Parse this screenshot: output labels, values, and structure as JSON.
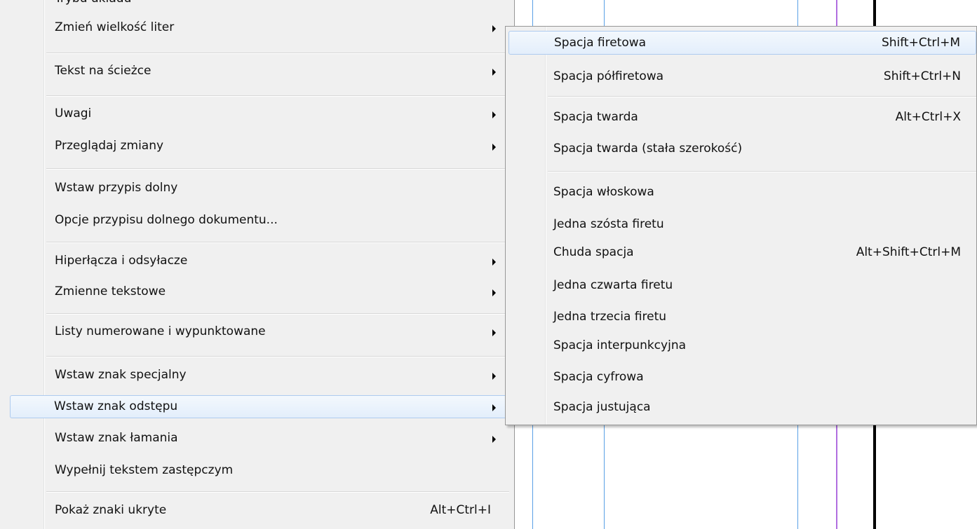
{
  "main_menu": {
    "partial_top_label": "Trybu układu",
    "items": [
      {
        "label": "Zmień wielkość liter",
        "shortcut": "",
        "submenu": true
      },
      {
        "label": "Tekst na ścieżce",
        "shortcut": "",
        "submenu": true
      },
      {
        "label": "Uwagi",
        "shortcut": "",
        "submenu": true
      },
      {
        "label": "Przeglądaj zmiany",
        "shortcut": "",
        "submenu": true
      },
      {
        "label": "Wstaw przypis dolny",
        "shortcut": "",
        "submenu": false
      },
      {
        "label": "Opcje przypisu dolnego dokumentu...",
        "shortcut": "",
        "submenu": false
      },
      {
        "label": "Hiperłącza i odsyłacze",
        "shortcut": "",
        "submenu": true
      },
      {
        "label": "Zmienne tekstowe",
        "shortcut": "",
        "submenu": true
      },
      {
        "label": "Listy numerowane i wypunktowane",
        "shortcut": "",
        "submenu": true
      },
      {
        "label": "Wstaw znak specjalny",
        "shortcut": "",
        "submenu": true
      },
      {
        "label": "Wstaw znak odstępu",
        "shortcut": "",
        "submenu": true,
        "highlighted": true
      },
      {
        "label": "Wstaw znak łamania",
        "shortcut": "",
        "submenu": true
      },
      {
        "label": "Wypełnij tekstem zastępczym",
        "shortcut": "",
        "submenu": false
      },
      {
        "label": "Pokaż znaki ukryte",
        "shortcut": "Alt+Ctrl+I",
        "submenu": false
      }
    ]
  },
  "sub_menu": {
    "items": [
      {
        "label": "Spacja firetowa",
        "shortcut": "Shift+Ctrl+M",
        "highlighted": true
      },
      {
        "label": "Spacja półfiretowa",
        "shortcut": "Shift+Ctrl+N"
      },
      {
        "label": "Spacja twarda",
        "shortcut": "Alt+Ctrl+X"
      },
      {
        "label": "Spacja twarda (stała szerokość)",
        "shortcut": ""
      },
      {
        "label": "Spacja włoskowa",
        "shortcut": ""
      },
      {
        "label": "Jedna szósta firetu",
        "shortcut": ""
      },
      {
        "label": "Chuda spacja",
        "shortcut": "Alt+Shift+Ctrl+M"
      },
      {
        "label": "Jedna czwarta firetu",
        "shortcut": ""
      },
      {
        "label": "Jedna trzecia firetu",
        "shortcut": ""
      },
      {
        "label": "Spacja interpunkcyjna",
        "shortcut": ""
      },
      {
        "label": "Spacja cyfrowa",
        "shortcut": ""
      },
      {
        "label": "Spacja justująca",
        "shortcut": ""
      }
    ]
  },
  "colors": {
    "menu_bg": "#f0f0f0",
    "highlight_border": "#aecbef",
    "guide_blue": "#5aa0e6",
    "guide_purple": "#b06ee0",
    "guide_black": "#000000"
  }
}
